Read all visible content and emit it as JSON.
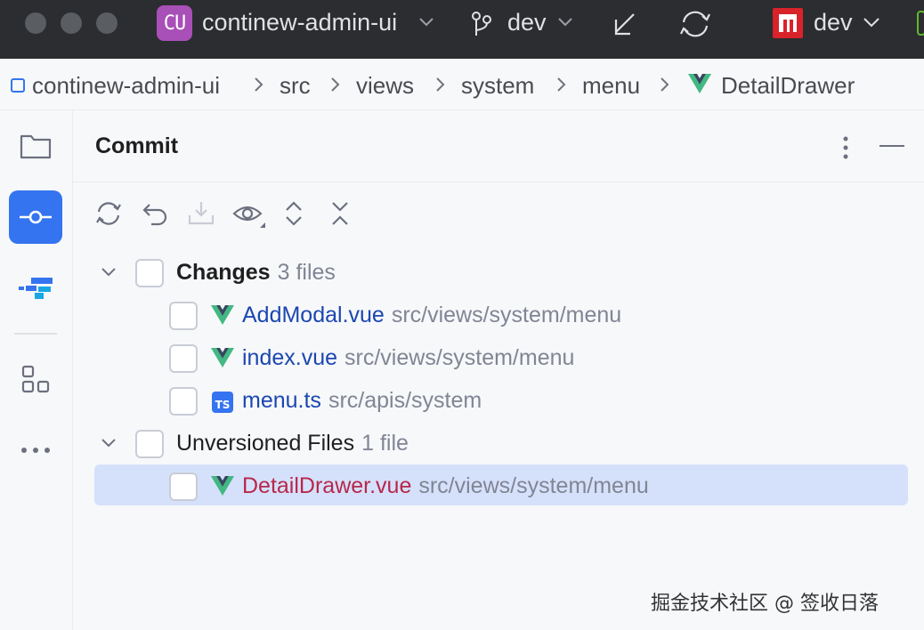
{
  "titlebar": {
    "project_badge": "CU",
    "project_name": "continew-admin-ui",
    "branch": "dev",
    "run_config": "dev",
    "icons": [
      "chevron-down-icon",
      "git-branch-icon",
      "update-project-icon",
      "sync-icon",
      "run-config-icon"
    ]
  },
  "breadcrumb": {
    "items": [
      "continew-admin-ui",
      "src",
      "views",
      "system",
      "menu",
      "DetailDrawer"
    ]
  },
  "toolstripe": {
    "items": [
      "project-icon",
      "commit-icon",
      "structure-icon",
      "plugins-icon",
      "more-icon"
    ],
    "active": "commit-icon"
  },
  "commit": {
    "title": "Commit",
    "toolbar": [
      "refresh-icon",
      "rollback-icon",
      "update-icon",
      "preview-icon",
      "expand-all-icon",
      "collapse-all-icon"
    ],
    "groups": [
      {
        "name": "Changes",
        "count": "3 files",
        "files": [
          {
            "name": "AddModal.vue",
            "path": "src/views/system/menu",
            "type": "vue"
          },
          {
            "name": "index.vue",
            "path": "src/views/system/menu",
            "type": "vue"
          },
          {
            "name": "menu.ts",
            "path": "src/apis/system",
            "type": "ts"
          }
        ]
      },
      {
        "name": "Unversioned Files",
        "count": "1 file",
        "files": [
          {
            "name": "DetailDrawer.vue",
            "path": "src/views/system/menu",
            "type": "vue"
          }
        ]
      }
    ],
    "ts_badge": "TS"
  },
  "watermark": "掘金技术社区 @ 签收日落",
  "colors": {
    "titlebar_bg": "#2b2d30",
    "accent": "#3574f0",
    "modified_file": "#1b47b0",
    "unversioned_file": "#b8274a",
    "selected_row": "#d5e1fb"
  }
}
